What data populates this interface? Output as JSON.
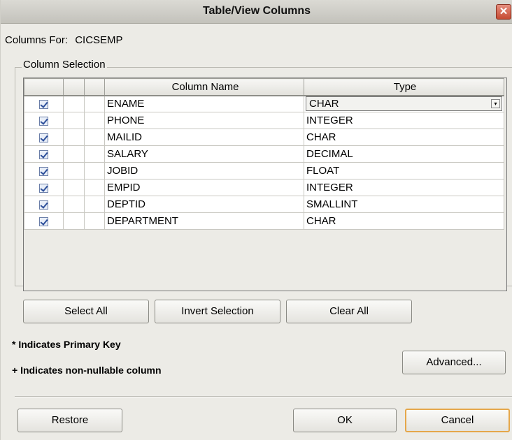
{
  "window": {
    "title": "Table/View Columns",
    "close_glyph": "✕"
  },
  "columns_for": {
    "label": "Columns For:",
    "value": "CICSEMP"
  },
  "column_selection": {
    "legend": "Column Selection",
    "headers": [
      "",
      "",
      "",
      "Column Name",
      "Type"
    ],
    "rows": [
      {
        "checked": true,
        "name": "ENAME",
        "type": "CHAR",
        "type_is_combo": true
      },
      {
        "checked": true,
        "name": "PHONE",
        "type": "INTEGER"
      },
      {
        "checked": true,
        "name": "MAILID",
        "type": "CHAR"
      },
      {
        "checked": true,
        "name": "SALARY",
        "type": "DECIMAL"
      },
      {
        "checked": true,
        "name": "JOBID",
        "type": "FLOAT"
      },
      {
        "checked": true,
        "name": "EMPID",
        "type": "INTEGER"
      },
      {
        "checked": true,
        "name": "DEPTID",
        "type": "SMALLINT"
      },
      {
        "checked": true,
        "name": "DEPARTMENT",
        "type": "CHAR"
      }
    ]
  },
  "buttons": {
    "select_all": "Select All",
    "invert_selection": "Invert Selection",
    "clear_all": "Clear All",
    "advanced": "Advanced...",
    "restore": "Restore",
    "ok": "OK",
    "cancel": "Cancel"
  },
  "notes": {
    "primary_key": "* Indicates Primary Key",
    "non_nullable": "+ Indicates non-nullable column"
  },
  "colors": {
    "dialog_bg": "#ecebe6",
    "default_button_border": "#e5a74a",
    "close_button": "#c64a32"
  }
}
